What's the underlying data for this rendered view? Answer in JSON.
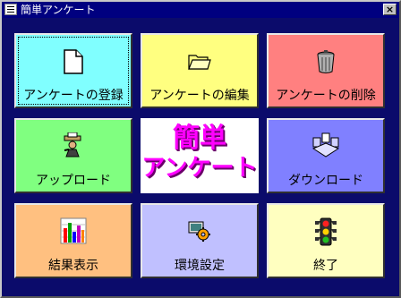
{
  "window": {
    "title": "簡単アンケート",
    "close_label": "×"
  },
  "tiles": [
    {
      "label": "アンケートの登録",
      "color": "#80ffff",
      "icon": "document-icon"
    },
    {
      "label": "アンケートの編集",
      "color": "#ffff80",
      "icon": "folder-icon"
    },
    {
      "label": "アンケートの削除",
      "color": "#ff8080",
      "icon": "trash-can-icon"
    },
    {
      "label": "アップロード",
      "color": "#80ff80",
      "icon": "upload-icon"
    },
    {
      "label": "ダウンロード",
      "color": "#8080ff",
      "icon": "download-icon"
    },
    {
      "label": "結果表示",
      "color": "#ffc080",
      "icon": "bar-chart-icon"
    },
    {
      "label": "環境設定",
      "color": "#c0c0ff",
      "icon": "settings-icon"
    },
    {
      "label": "終了",
      "color": "#ffffc0",
      "icon": "traffic-light-icon"
    }
  ],
  "logo": {
    "line1": "簡単",
    "line2": "アンケート"
  }
}
